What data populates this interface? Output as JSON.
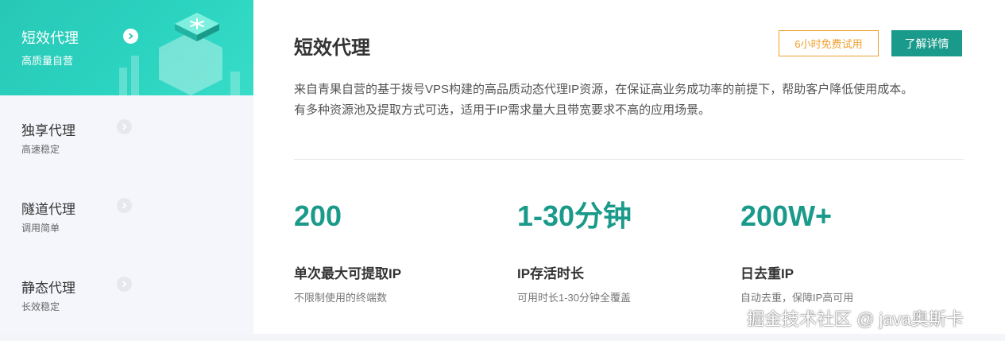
{
  "sidebar": {
    "items": [
      {
        "title": "短效代理",
        "subtitle": "高质量自营",
        "active": true
      },
      {
        "title": "独享代理",
        "subtitle": "高速稳定",
        "active": false
      },
      {
        "title": "隧道代理",
        "subtitle": "调用简单",
        "active": false
      },
      {
        "title": "静态代理",
        "subtitle": "长效稳定",
        "active": false
      }
    ]
  },
  "main": {
    "title": "短效代理",
    "trial_button": "6小时免费试用",
    "detail_button": "了解详情",
    "description_line1": "来自青果自营的基于拨号VPS构建的高品质动态代理IP资源，在保证高业务成功率的前提下，帮助客户降低使用成本。",
    "description_line2": "有多种资源池及提取方式可选，适用于IP需求量大且带宽要求不高的应用场景。",
    "stats": [
      {
        "value": "200",
        "label": "单次最大可提取IP",
        "desc": "不限制使用的终端数"
      },
      {
        "value": "1-30分钟",
        "label": "IP存活时长",
        "desc": "可用时长1-30分钟全覆盖"
      },
      {
        "value": "200W+",
        "label": "日去重IP",
        "desc": "自动去重，保障IP高可用"
      }
    ]
  },
  "watermark": "掘金技术社区 @ java奥斯卡",
  "colors": {
    "accent": "#1a9a8a",
    "active_gradient": "#2bd4c0",
    "trial_border": "#f0a030"
  }
}
